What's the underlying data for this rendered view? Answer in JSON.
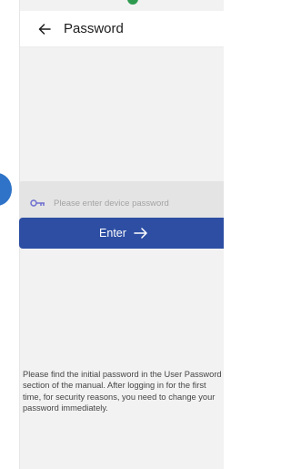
{
  "header": {
    "title": "Password",
    "back_icon": "arrow-left-icon"
  },
  "password_field": {
    "placeholder": "Please enter device password",
    "value": "",
    "icon": "key-icon"
  },
  "enter_button": {
    "label": "Enter",
    "icon": "arrow-right-icon"
  },
  "note": "Please find the initial password in the User Password section of the manual. After logging in for the first time, for security reasons, you need to change your password immediately.",
  "colors": {
    "primary": "#2d4ea3",
    "background": "#f2f2f2",
    "field": "#e4e4e4",
    "key_icon": "#6e6fd0",
    "status_dot": "#2e9a4f",
    "side_circle": "#2f73c8"
  }
}
